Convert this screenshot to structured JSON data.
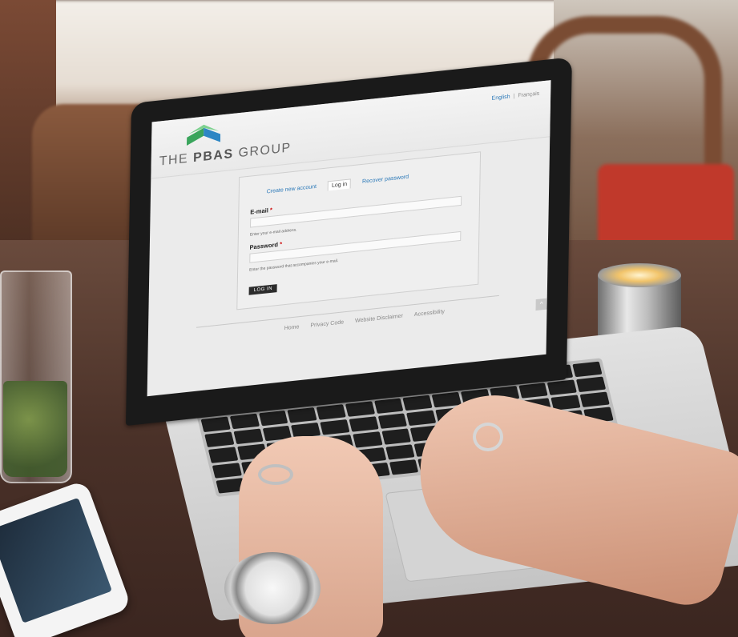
{
  "site": {
    "logo_text_light": "THE",
    "logo_text_bold": "PBAS",
    "logo_text_tail": "GROUP",
    "logo_colors": {
      "green": "#3aa55c",
      "blue": "#2d86c4"
    }
  },
  "language": {
    "english": "English",
    "separator": "|",
    "french": "Français"
  },
  "tabs": [
    {
      "label": "Create new account"
    },
    {
      "label": "Log in"
    },
    {
      "label": "Recover password"
    }
  ],
  "form": {
    "email_label": "E-mail",
    "email_help": "Enter your e-mail address.",
    "password_label": "Password",
    "password_help": "Enter the password that accompanies your e-mail.",
    "required_marker": "*",
    "submit_label": "LOG IN"
  },
  "footer": {
    "links": [
      {
        "label": "Home"
      },
      {
        "label": "Privacy Code"
      },
      {
        "label": "Website Disclaimer"
      },
      {
        "label": "Accessibility"
      }
    ],
    "scroll_top_icon": "^"
  }
}
